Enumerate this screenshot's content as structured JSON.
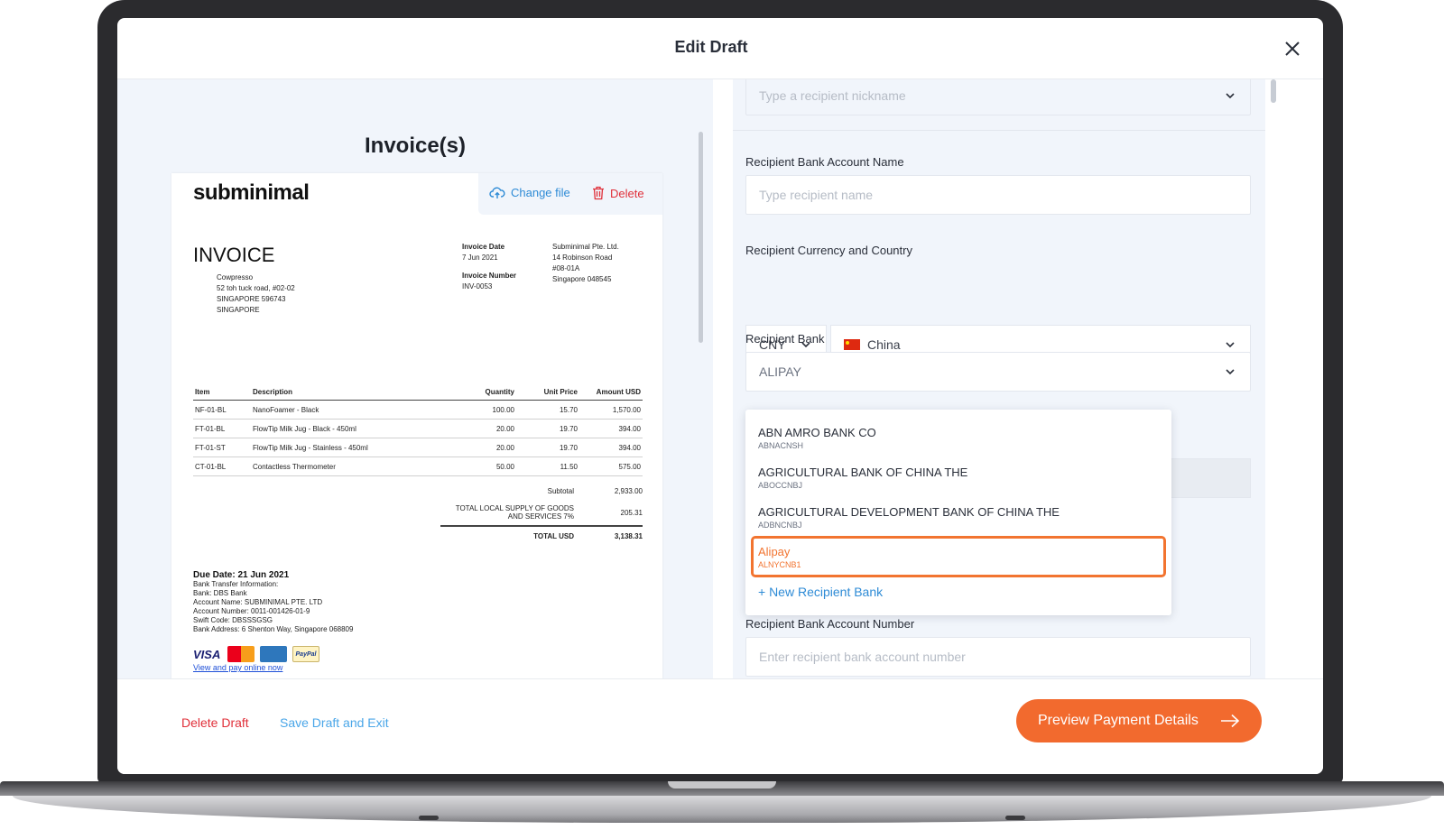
{
  "modal": {
    "title": "Edit Draft"
  },
  "invoice_panel": {
    "title": "Invoice(s)",
    "change_file_label": "Change file",
    "delete_label": "Delete",
    "document": {
      "brand": "subminimal",
      "heading": "INVOICE",
      "bill_to": [
        "Cowpresso",
        "52 toh tuck road, #02-02",
        "SINGAPORE 596743",
        "SINGAPORE"
      ],
      "invoice_date_label": "Invoice Date",
      "invoice_date": "7 Jun 2021",
      "invoice_number_label": "Invoice Number",
      "invoice_number": "INV-0053",
      "seller": [
        "Subminimal Pte. Ltd.",
        "14 Robinson Road",
        "#08-01A",
        "Singapore 048545"
      ],
      "columns": [
        "Item",
        "Description",
        "Quantity",
        "Unit Price",
        "Amount USD"
      ],
      "rows": [
        [
          "NF-01-BL",
          "NanoFoamer - Black",
          "100.00",
          "15.70",
          "1,570.00"
        ],
        [
          "FT-01-BL",
          "FlowTip Milk Jug - Black - 450ml",
          "20.00",
          "19.70",
          "394.00"
        ],
        [
          "FT-01-ST",
          "FlowTip Milk Jug - Stainless - 450ml",
          "20.00",
          "19.70",
          "394.00"
        ],
        [
          "CT-01-BL",
          "Contactless Thermometer",
          "50.00",
          "11.50",
          "575.00"
        ]
      ],
      "subtotal_label": "Subtotal",
      "subtotal": "2,933.00",
      "gst_label": "TOTAL LOCAL SUPPLY OF GOODS AND SERVICES 7%",
      "gst": "205.31",
      "total_label": "TOTAL USD",
      "total": "3,138.31",
      "due_date": "Due Date: 21 Jun 2021",
      "bank_lines": [
        "Bank Transfer Information:",
        "Bank: DBS Bank",
        "Account Name: SUBMINIMAL PTE. LTD",
        "Account Number: 0011-001426-01-9",
        "Swift Code: DBSSSGSG",
        "Bank Address: 6 Shenton Way, Singapore 068809"
      ],
      "visa": "VISA",
      "paypal": "PayPal",
      "pay_link": "View and pay online now"
    }
  },
  "form": {
    "nickname_placeholder": "Type a recipient nickname",
    "account_name_label": "Recipient Bank Account Name",
    "account_name_placeholder": "Type recipient name",
    "currency_country_label": "Recipient Currency and Country",
    "currency": "CNY",
    "country": "China",
    "bank_label": "Recipient Bank",
    "bank_value": "ALIPAY",
    "bank_options": [
      {
        "name": "ABN AMRO BANK CO",
        "code": "ABNACNSH"
      },
      {
        "name": "AGRICULTURAL BANK OF CHINA THE",
        "code": "ABOCCNBJ"
      },
      {
        "name": "AGRICULTURAL DEVELOPMENT BANK OF CHINA THE",
        "code": "ADBNCNBJ"
      },
      {
        "name": "Alipay",
        "code": "ALNYCNB1"
      }
    ],
    "new_bank_label": "+ New Recipient Bank",
    "account_number_label": "Recipient Bank Account Number",
    "account_number_placeholder": "Enter recipient bank account number"
  },
  "footer": {
    "delete_draft": "Delete  Draft",
    "save_draft": "Save Draft and Exit",
    "preview": "Preview Payment Details"
  },
  "colors": {
    "accent": "#f26a2e",
    "link": "#2e8bd6",
    "danger": "#e0303a"
  }
}
